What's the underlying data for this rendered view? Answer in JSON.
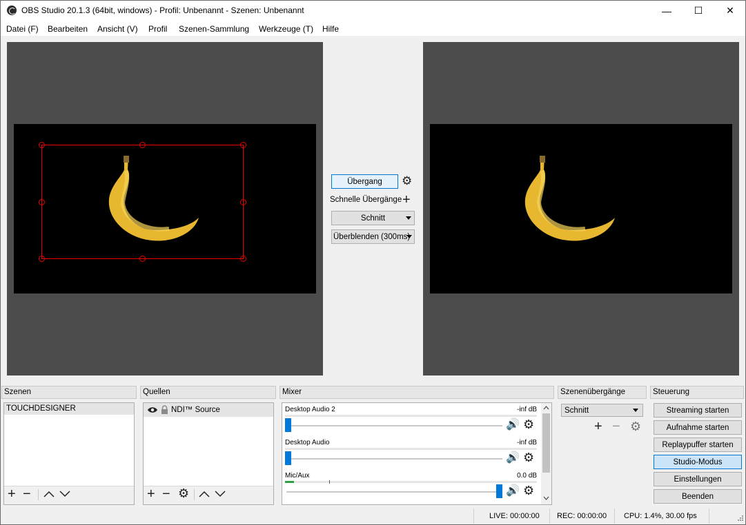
{
  "window": {
    "title": "OBS Studio 20.1.3 (64bit, windows) - Profil: Unbenannt - Szenen: Unbenannt",
    "minimize": "—",
    "maximize": "☐",
    "close": "✕"
  },
  "menu": [
    "Datei (F)",
    "Bearbeiten",
    "Ansicht (V)",
    "Profil",
    "Szenen-Sammlung",
    "Werkzeuge (T)",
    "Hilfe"
  ],
  "transition_panel": {
    "transition_button": "Übergang",
    "quick_transitions_label": "Schnelle Übergänge",
    "quick_1": "Schnitt",
    "quick_2": "Überblenden (300ms)"
  },
  "docks": {
    "scenes": {
      "title": "Szenen",
      "items": [
        "TOUCHDESIGNER"
      ]
    },
    "sources": {
      "title": "Quellen",
      "items": [
        "NDI™ Source"
      ]
    },
    "mixer": {
      "title": "Mixer",
      "channels": [
        {
          "name": "Desktop Audio 2",
          "level": "-inf dB",
          "volume": 0.0
        },
        {
          "name": "Desktop Audio",
          "level": "-inf dB",
          "volume": 0.0
        },
        {
          "name": "Mic/Aux",
          "level": "0.0 dB",
          "volume": 1.0
        }
      ]
    },
    "transitions": {
      "title": "Szenenübergänge",
      "selected": "Schnitt"
    },
    "controls": {
      "title": "Steuerung",
      "buttons": [
        "Streaming starten",
        "Aufnahme starten",
        "Replaypuffer starten",
        "Studio-Modus",
        "Einstellungen",
        "Beenden"
      ]
    }
  },
  "status": {
    "live": "LIVE: 00:00:00",
    "rec": "REC: 00:00:00",
    "cpu": "CPU: 1.4%, 30.00 fps"
  },
  "colors": {
    "preview_bg": "#4c4c4c",
    "selection_box": "#e00000",
    "accent": "#0078d7"
  }
}
